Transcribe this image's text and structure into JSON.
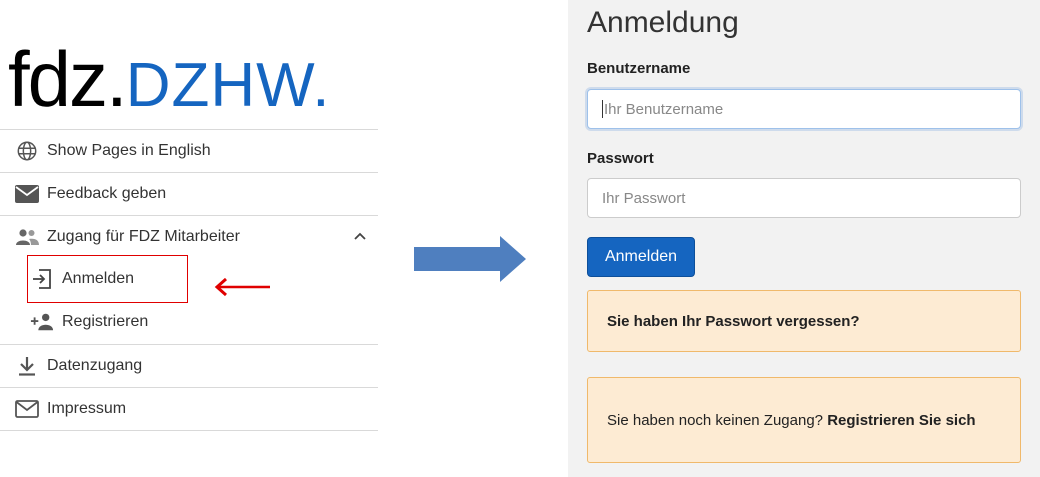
{
  "sidebar": {
    "logo": {
      "part1": "fdz.",
      "part2": "DZHW."
    },
    "items": [
      {
        "label": "Show Pages in English",
        "icon": "globe-icon"
      },
      {
        "label": "Feedback geben",
        "icon": "mail-filled-icon"
      },
      {
        "label": "Zugang für FDZ Mitarbeiter",
        "icon": "people-icon",
        "expanded": true,
        "children": [
          {
            "label": "Anmelden",
            "icon": "login-icon"
          },
          {
            "label": "Registrieren",
            "icon": "person-add-icon"
          }
        ]
      },
      {
        "label": "Datenzugang",
        "icon": "download-icon"
      },
      {
        "label": "Impressum",
        "icon": "mail-outline-icon"
      }
    ]
  },
  "login": {
    "title": "Anmeldung",
    "username_label": "Benutzername",
    "username_placeholder": "Ihr Benutzername",
    "password_label": "Passwort",
    "password_placeholder": "Ihr Passwort",
    "submit_label": "Anmelden",
    "forgot_text": "Sie haben Ihr Passwort vergessen?",
    "register_prefix": "Sie haben noch keinen Zugang? ",
    "register_link": "Registrieren Sie sich"
  },
  "colors": {
    "brand_blue": "#1565c0",
    "annotation_red": "#e00000",
    "arrow_blue": "#4f7fbf",
    "notice_bg": "#fdebd3",
    "notice_border": "#f0b96b"
  }
}
